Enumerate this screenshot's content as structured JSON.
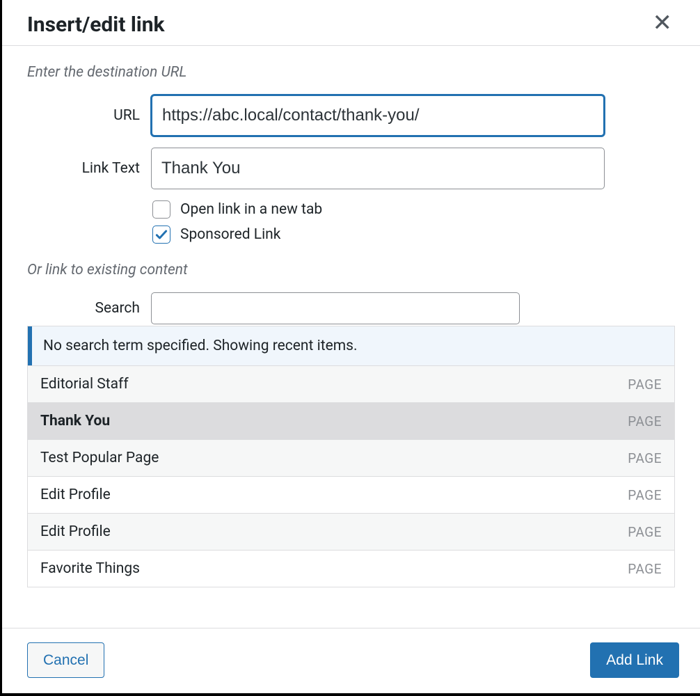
{
  "dialog": {
    "title": "Insert/edit link",
    "section1_hint": "Enter the destination URL",
    "url_label": "URL",
    "url_value": "https://abc.local/contact/thank-you/",
    "link_text_label": "Link Text",
    "link_text_value": "Thank You",
    "open_new_tab_label": "Open link in a new tab",
    "open_new_tab_checked": false,
    "sponsored_label": "Sponsored Link",
    "sponsored_checked": true,
    "section2_hint": "Or link to existing content",
    "search_label": "Search",
    "search_value": "",
    "results_banner": "No search term specified. Showing recent items.",
    "results": [
      {
        "title": "Editorial Staff",
        "type": "PAGE",
        "alt": true,
        "selected": false
      },
      {
        "title": "Thank You",
        "type": "PAGE",
        "alt": false,
        "selected": true
      },
      {
        "title": "Test Popular Page",
        "type": "PAGE",
        "alt": true,
        "selected": false
      },
      {
        "title": "Edit Profile",
        "type": "PAGE",
        "alt": false,
        "selected": false
      },
      {
        "title": "Edit Profile",
        "type": "PAGE",
        "alt": true,
        "selected": false
      },
      {
        "title": "Favorite Things",
        "type": "PAGE",
        "alt": false,
        "selected": false
      }
    ],
    "cancel_label": "Cancel",
    "submit_label": "Add Link"
  }
}
